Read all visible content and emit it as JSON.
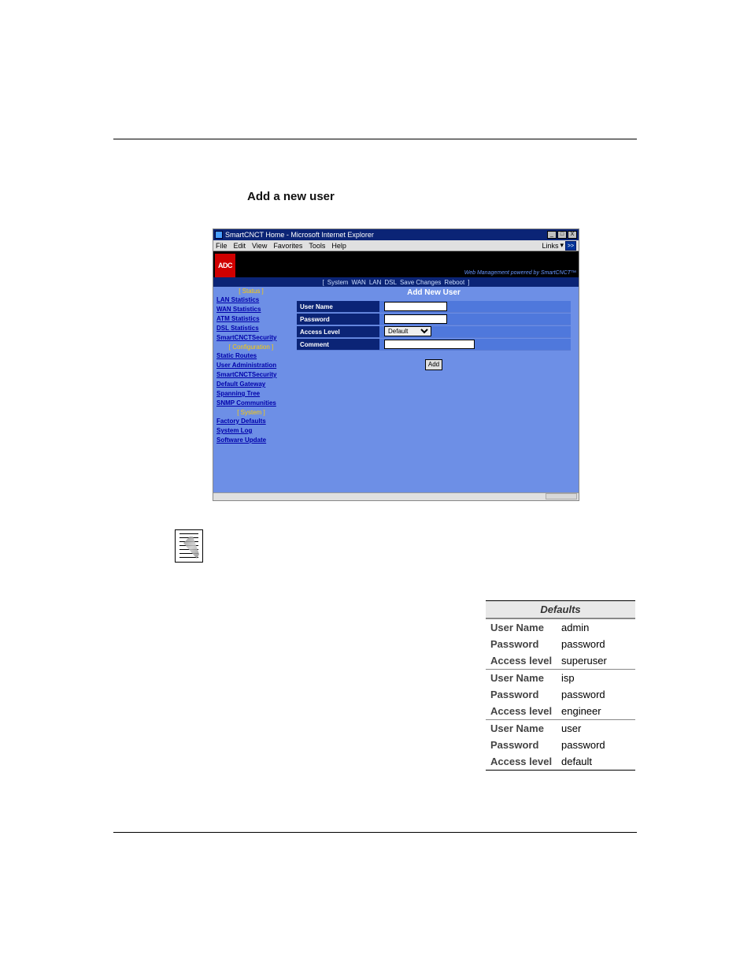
{
  "section_heading": "Add a new user",
  "window": {
    "title": "SmartCNCT Home - Microsoft Internet Explorer",
    "menus": [
      "File",
      "Edit",
      "View",
      "Favorites",
      "Tools",
      "Help"
    ],
    "links_label": "Links",
    "go_label": ">>"
  },
  "branding": {
    "logo": "ADC",
    "tagline": "Web Management powered by SmartCNCT™"
  },
  "topnav": {
    "open": "[",
    "items": [
      "System",
      "WAN",
      "LAN",
      "DSL",
      "Save Changes",
      "Reboot"
    ],
    "close": "]"
  },
  "sidebar": {
    "cat_status": "[ Status ]",
    "status_links": [
      "LAN Statistics",
      "WAN Statistics",
      "ATM Statistics",
      "DSL Statistics",
      "SmartCNCTSecurity"
    ],
    "cat_config": "[ Configuration ]",
    "config_links": [
      "Static Routes",
      "User Administration",
      "SmartCNCTSecurity",
      "Default Gateway",
      "Spanning Tree",
      "SNMP Communities"
    ],
    "cat_system": "[ System ]",
    "system_links": [
      "Factory Defaults",
      "System Log",
      "Software Update"
    ]
  },
  "main": {
    "title": "Add New User",
    "labels": {
      "user": "User Name",
      "pass": "Password",
      "level": "Access Level",
      "comment": "Comment"
    },
    "level_value": "Default",
    "add_button": "Add"
  },
  "defaults": {
    "heading": "Defaults",
    "rows": [
      {
        "label": "User Name",
        "value": "admin"
      },
      {
        "label": "Password",
        "value": "password"
      },
      {
        "label": "Access level",
        "value": "superuser"
      },
      {
        "label": "User Name",
        "value": "isp"
      },
      {
        "label": "Password",
        "value": "password"
      },
      {
        "label": "Access level",
        "value": "engineer"
      },
      {
        "label": "User Name",
        "value": "user"
      },
      {
        "label": "Password",
        "value": "password"
      },
      {
        "label": "Access level",
        "value": "default"
      }
    ]
  }
}
